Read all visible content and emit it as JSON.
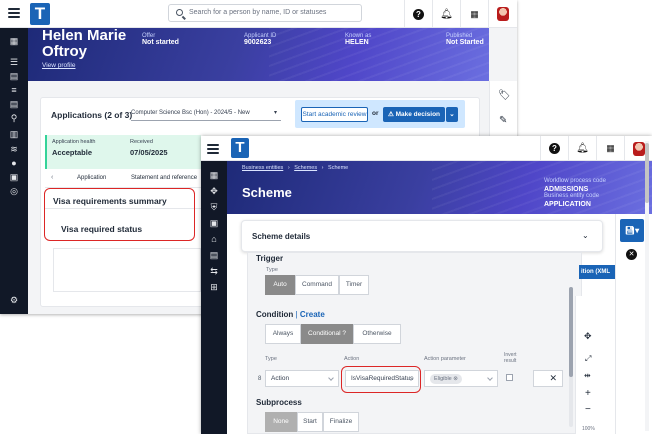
{
  "back": {
    "search_placeholder": "Search for a person by name, ID or statuses",
    "student_name_line1": "Helen Marie",
    "student_name_line2": "Oftroy",
    "view_profile": "View profile",
    "fields": [
      {
        "label": "Offer",
        "value": "Not started"
      },
      {
        "label": "Applicant ID",
        "value": "9002623"
      },
      {
        "label": "Known as",
        "value": "HELEN"
      },
      {
        "label": "Published",
        "value": "Not Started"
      }
    ],
    "applications_title": "Applications (2 of 3)",
    "application_select": "Computer Science Bsc (Hon) - 2024/5 - New",
    "start_review": "Start academic review",
    "or": "or",
    "make_decision": "Make decision",
    "health_label": "Application health",
    "health_value": "Acceptable",
    "received_label": "Received",
    "received_value": "07/05/2025",
    "tabs": [
      "Application",
      "Statement and reference"
    ],
    "visa_summary_title": "Visa requirements summary",
    "visa_required_status": "Visa required status"
  },
  "front": {
    "breadcrumb": [
      "Business entities",
      "Schemes",
      "Scheme"
    ],
    "title": "Scheme",
    "workflow_label": "Workflow process code",
    "workflow_value": "ADMISSIONS",
    "entity_label": "Business entity code",
    "entity_value": "APPLICATION",
    "scheme_details": "Scheme details",
    "trigger_title": "Trigger",
    "type_label": "Type",
    "trigger_types": [
      "Auto",
      "Command",
      "Timer"
    ],
    "condition_title": "Condition",
    "condition_sep": "|",
    "condition_create": "Create",
    "condition_modes": [
      "Always",
      "Conditional ?",
      "Otherwise"
    ],
    "col_type": "Type",
    "col_action": "Action",
    "col_param": "Action parameter",
    "col_invert_line1": "Invert",
    "col_invert_line2": "result",
    "row_index": "8",
    "row_type": "Action",
    "row_action": "IsVisaRequiredStatus",
    "row_param": "Eligible",
    "subprocess_title": "Subprocess",
    "subprocess_modes": [
      "None",
      "Start",
      "Finalize"
    ],
    "side_button_text": "ition (XML",
    "zoom_text": "100%"
  },
  "colors": {
    "brand": "#1a64b6",
    "highlight": "#dc2626",
    "sidebar": "#111827"
  }
}
